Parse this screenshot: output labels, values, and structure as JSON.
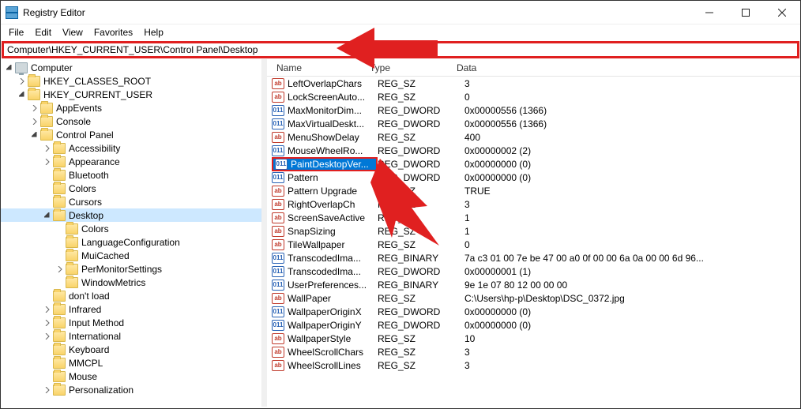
{
  "window": {
    "title": "Registry Editor"
  },
  "menu": {
    "file": "File",
    "edit": "Edit",
    "view": "View",
    "favorites": "Favorites",
    "help": "Help"
  },
  "address": "Computer\\HKEY_CURRENT_USER\\Control Panel\\Desktop",
  "tree": [
    {
      "depth": 0,
      "label": "Computer",
      "expanded": true,
      "icon": "computer"
    },
    {
      "depth": 1,
      "label": "HKEY_CLASSES_ROOT",
      "expanded": false,
      "hasCaret": true
    },
    {
      "depth": 1,
      "label": "HKEY_CURRENT_USER",
      "expanded": true,
      "hasCaret": true
    },
    {
      "depth": 2,
      "label": "AppEvents",
      "expanded": false,
      "hasCaret": true
    },
    {
      "depth": 2,
      "label": "Console",
      "expanded": false,
      "hasCaret": true
    },
    {
      "depth": 2,
      "label": "Control Panel",
      "expanded": true,
      "hasCaret": true
    },
    {
      "depth": 3,
      "label": "Accessibility",
      "expanded": false,
      "hasCaret": true
    },
    {
      "depth": 3,
      "label": "Appearance",
      "expanded": false,
      "hasCaret": true
    },
    {
      "depth": 3,
      "label": "Bluetooth",
      "expanded": false,
      "hasCaret": false
    },
    {
      "depth": 3,
      "label": "Colors",
      "expanded": false,
      "hasCaret": false
    },
    {
      "depth": 3,
      "label": "Cursors",
      "expanded": false,
      "hasCaret": false
    },
    {
      "depth": 3,
      "label": "Desktop",
      "expanded": true,
      "hasCaret": true,
      "selected": true
    },
    {
      "depth": 4,
      "label": "Colors",
      "expanded": false,
      "hasCaret": false
    },
    {
      "depth": 4,
      "label": "LanguageConfiguration",
      "expanded": false,
      "hasCaret": false
    },
    {
      "depth": 4,
      "label": "MuiCached",
      "expanded": false,
      "hasCaret": false
    },
    {
      "depth": 4,
      "label": "PerMonitorSettings",
      "expanded": false,
      "hasCaret": true
    },
    {
      "depth": 4,
      "label": "WindowMetrics",
      "expanded": false,
      "hasCaret": false
    },
    {
      "depth": 3,
      "label": "don't load",
      "expanded": false,
      "hasCaret": false
    },
    {
      "depth": 3,
      "label": "Infrared",
      "expanded": false,
      "hasCaret": true
    },
    {
      "depth": 3,
      "label": "Input Method",
      "expanded": false,
      "hasCaret": true
    },
    {
      "depth": 3,
      "label": "International",
      "expanded": false,
      "hasCaret": true
    },
    {
      "depth": 3,
      "label": "Keyboard",
      "expanded": false,
      "hasCaret": false
    },
    {
      "depth": 3,
      "label": "MMCPL",
      "expanded": false,
      "hasCaret": false
    },
    {
      "depth": 3,
      "label": "Mouse",
      "expanded": false,
      "hasCaret": false
    },
    {
      "depth": 3,
      "label": "Personalization",
      "expanded": false,
      "hasCaret": true
    }
  ],
  "columns": {
    "name": "Name",
    "type": "Type",
    "data": "Data"
  },
  "values": [
    {
      "name": "LeftOverlapChars",
      "type": "REG_SZ",
      "icon": "sz",
      "data": "3"
    },
    {
      "name": "LockScreenAuto...",
      "type": "REG_SZ",
      "icon": "sz",
      "data": "0"
    },
    {
      "name": "MaxMonitorDim...",
      "type": "REG_DWORD",
      "icon": "dw",
      "data": "0x00000556 (1366)"
    },
    {
      "name": "MaxVirtualDeskt...",
      "type": "REG_DWORD",
      "icon": "dw",
      "data": "0x00000556 (1366)"
    },
    {
      "name": "MenuShowDelay",
      "type": "REG_SZ",
      "icon": "sz",
      "data": "400"
    },
    {
      "name": "MouseWheelRo...",
      "type": "REG_DWORD",
      "icon": "dw",
      "data": "0x00000002 (2)"
    },
    {
      "name": "PaintDesktopVer...",
      "type": "REG_DWORD",
      "icon": "dw",
      "data": "0x00000000 (0)",
      "selected": true
    },
    {
      "name": "Pattern",
      "type": "REG_DWORD",
      "icon": "dw",
      "data": "0x00000000 (0)"
    },
    {
      "name": "Pattern Upgrade",
      "type": "REG_SZ",
      "icon": "sz",
      "data": "TRUE"
    },
    {
      "name": "RightOverlapCh",
      "type": "REG_SZ",
      "icon": "sz",
      "data": "3"
    },
    {
      "name": "ScreenSaveActive",
      "type": "REG_SZ",
      "icon": "sz",
      "data": "1"
    },
    {
      "name": "SnapSizing",
      "type": "REG_SZ",
      "icon": "sz",
      "data": "1"
    },
    {
      "name": "TileWallpaper",
      "type": "REG_SZ",
      "icon": "sz",
      "data": "0"
    },
    {
      "name": "TranscodedIma...",
      "type": "REG_BINARY",
      "icon": "dw",
      "data": "7a c3 01 00 7e be 47 00 a0 0f 00 00 6a 0a 00 00 6d 96..."
    },
    {
      "name": "TranscodedIma...",
      "type": "REG_DWORD",
      "icon": "dw",
      "data": "0x00000001 (1)"
    },
    {
      "name": "UserPreferences...",
      "type": "REG_BINARY",
      "icon": "dw",
      "data": "9e 1e 07 80 12 00 00 00"
    },
    {
      "name": "WallPaper",
      "type": "REG_SZ",
      "icon": "sz",
      "data": "C:\\Users\\hp-p\\Desktop\\DSC_0372.jpg"
    },
    {
      "name": "WallpaperOriginX",
      "type": "REG_DWORD",
      "icon": "dw",
      "data": "0x00000000 (0)"
    },
    {
      "name": "WallpaperOriginY",
      "type": "REG_DWORD",
      "icon": "dw",
      "data": "0x00000000 (0)"
    },
    {
      "name": "WallpaperStyle",
      "type": "REG_SZ",
      "icon": "sz",
      "data": "10"
    },
    {
      "name": "WheelScrollChars",
      "type": "REG_SZ",
      "icon": "sz",
      "data": "3"
    },
    {
      "name": "WheelScrollLines",
      "type": "REG_SZ",
      "icon": "sz",
      "data": "3"
    }
  ]
}
